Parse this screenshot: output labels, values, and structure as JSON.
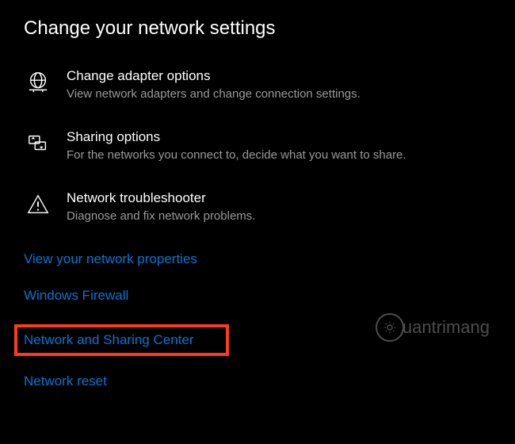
{
  "heading": "Change your network settings",
  "options": [
    {
      "title": "Change adapter options",
      "desc": "View network adapters and change connection settings."
    },
    {
      "title": "Sharing options",
      "desc": "For the networks you connect to, decide what you want to share."
    },
    {
      "title": "Network troubleshooter",
      "desc": "Diagnose and fix network problems."
    }
  ],
  "links": {
    "properties": "View your network properties",
    "firewall": "Windows Firewall",
    "sharing_center": "Network and Sharing Center",
    "reset": "Network reset"
  },
  "watermark": "uantrimang"
}
